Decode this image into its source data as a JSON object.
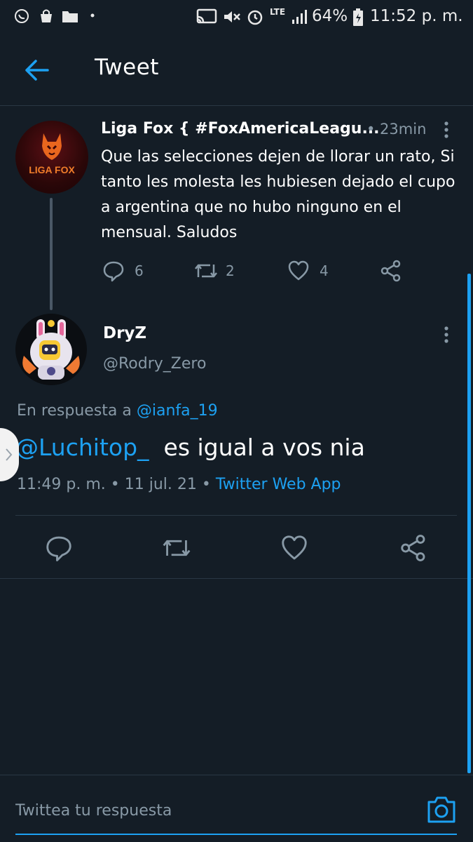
{
  "status_bar": {
    "battery": "64%",
    "network": "LTE",
    "time": "11:52 p. m."
  },
  "header": {
    "title": "Tweet"
  },
  "parent_tweet": {
    "avatar_text": "LIGA FOX",
    "name": "Liga Fox { #FoxAmericaLeagu...",
    "time": "• 23min",
    "text": "Que las selecciones dejen de llorar un rato, Si tanto les molesta les hubiesen dejado el cupo a argentina que no hubo ninguno en el mensual. Saludos",
    "replies": "6",
    "retweets": "2",
    "likes": "4"
  },
  "reply_tweet": {
    "name": "DryZ",
    "handle": "@Rodry_Zero",
    "reply_prefix": "En respuesta a ",
    "reply_mention": "@ianfa_19",
    "mention": "@Luchitop_",
    "text": "  es igual a vos nia",
    "time": "11:49 p. m.",
    "date": " • 11 jul. 21 • ",
    "source": "Twitter Web App"
  },
  "composer": {
    "placeholder": "Twittea tu respuesta"
  },
  "colors": {
    "background": "#141d26",
    "accent": "#1da1f2",
    "secondary_text": "#8899a6"
  },
  "icons": [
    "back-arrow-icon",
    "more-vertical-icon",
    "reply-icon",
    "retweet-icon",
    "like-icon",
    "share-icon",
    "camera-icon"
  ]
}
